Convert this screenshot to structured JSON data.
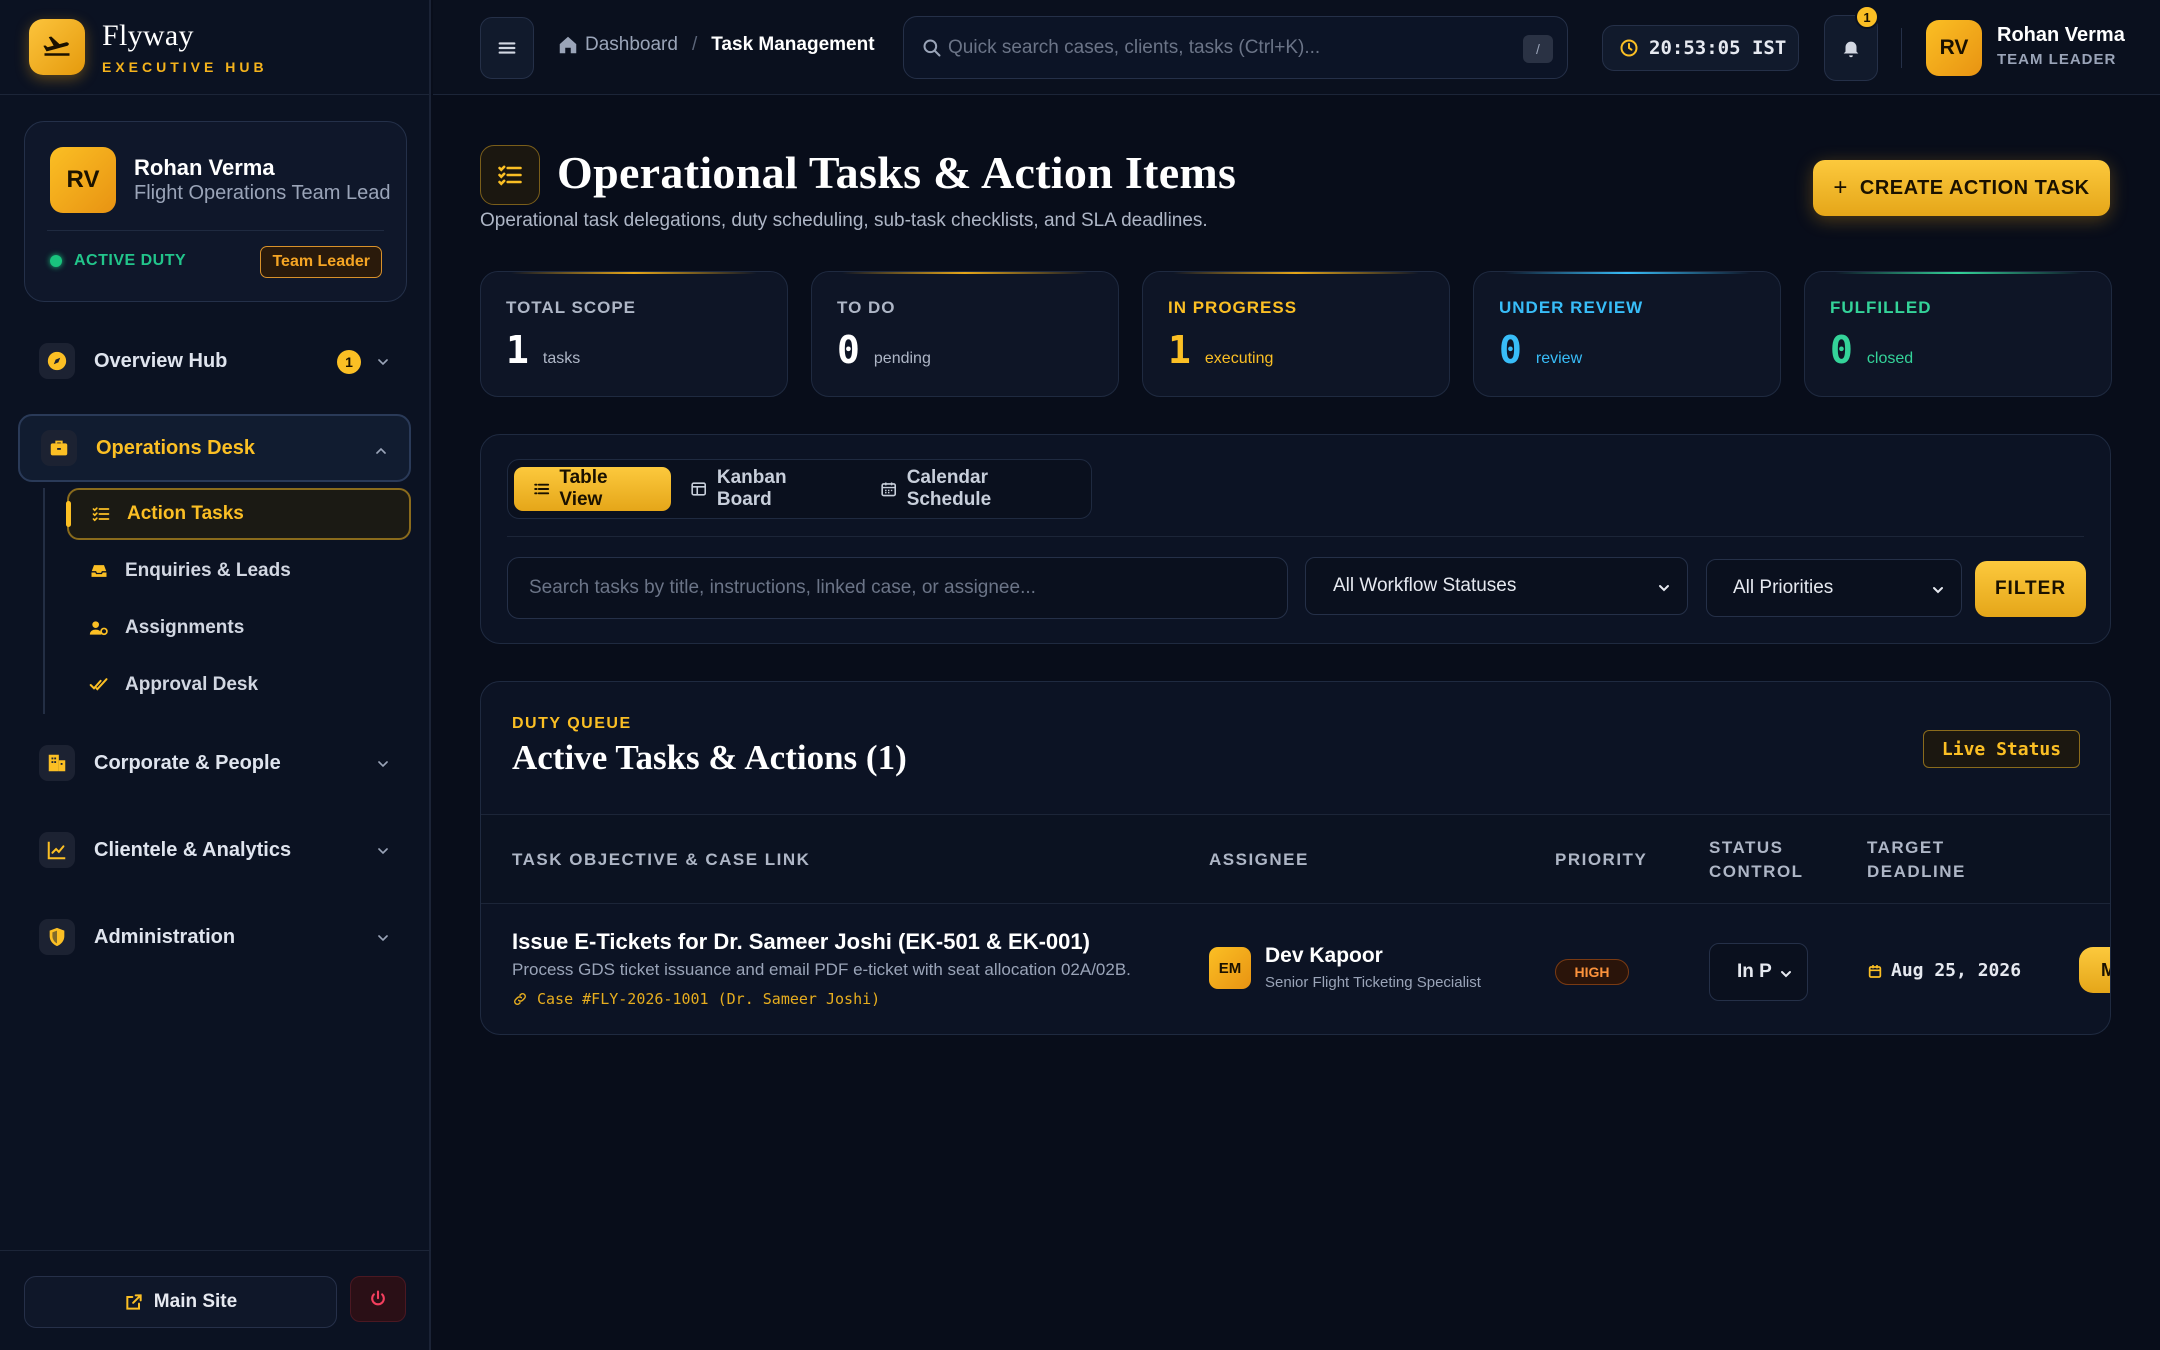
{
  "brand": {
    "title": "Flyway",
    "subtitle": "EXECUTIVE HUB"
  },
  "profile": {
    "initials": "RV",
    "name": "Rohan Verma",
    "role": "Flight Operations Team Lead",
    "status": "ACTIVE DUTY",
    "badge": "Team Leader"
  },
  "nav": {
    "overview": {
      "label": "Overview Hub",
      "count": "1"
    },
    "operations": {
      "label": "Operations Desk"
    },
    "sub": [
      {
        "label": "Action Tasks"
      },
      {
        "label": "Enquiries & Leads"
      },
      {
        "label": "Assignments"
      },
      {
        "label": "Approval Desk"
      }
    ],
    "corporate": {
      "label": "Corporate & People"
    },
    "clientele": {
      "label": "Clientele & Analytics"
    },
    "admin": {
      "label": "Administration"
    }
  },
  "footer": {
    "main_site": "Main Site"
  },
  "topbar": {
    "breadcrumb_home": "Dashboard",
    "breadcrumb_sep": "/",
    "breadcrumb_current": "Task Management",
    "search_placeholder": "Quick search cases, clients, tasks (Ctrl+K)...",
    "search_kbd": "/",
    "clock": "20:53:05 IST",
    "notif_count": "1",
    "user_initials": "RV",
    "user_name": "Rohan Verma",
    "user_role": "TEAM LEADER"
  },
  "page": {
    "title": "Operational Tasks & Action Items",
    "subtitle": "Operational task delegations, duty scheduling, sub-task checklists, and SLA deadlines.",
    "create_plus": "+",
    "create_label": "CREATE ACTION TASK"
  },
  "stats": [
    {
      "label": "TOTAL SCOPE",
      "value": "1",
      "unit": "tasks",
      "color": "#aeb6c6",
      "accent": "#e5a619"
    },
    {
      "label": "TO DO",
      "value": "0",
      "unit": "pending",
      "color": "#aeb6c6",
      "accent": "#e5a619"
    },
    {
      "label": "IN PROGRESS",
      "value": "1",
      "unit": "executing",
      "color": "#fbbf24",
      "accent": "#e5a619"
    },
    {
      "label": "UNDER REVIEW",
      "value": "0",
      "unit": "review",
      "color": "#38bdf8",
      "accent": "#38bdf8"
    },
    {
      "label": "FULFILLED",
      "value": "0",
      "unit": "closed",
      "color": "#34d399",
      "accent": "#34d399"
    }
  ],
  "views": {
    "table": "Table View",
    "kanban": "Kanban Board",
    "calendar": "Calendar Schedule"
  },
  "filters": {
    "search_placeholder": "Search tasks by title, instructions, linked case, or assignee...",
    "status_selected": "All Workflow Statuses",
    "priority_selected": "All Priorities",
    "filter_button": "FILTER"
  },
  "queue": {
    "eyebrow": "DUTY QUEUE",
    "title": "Active Tasks & Actions (1)",
    "live_label": "Live Status",
    "headers": {
      "task": "TASK OBJECTIVE & CASE LINK",
      "assignee": "ASSIGNEE",
      "priority": "PRIORITY",
      "status_1": "STATUS",
      "status_2": "CONTROL",
      "deadline_1": "TARGET",
      "deadline_2": "DEADLINE"
    },
    "rows": [
      {
        "title": "Issue E-Tickets for Dr. Sameer Joshi (EK-501 & EK-001)",
        "description": "Process GDS ticket issuance and email PDF e-ticket with seat allocation 02A/02B.",
        "case_link": "Case #FLY-2026-1001 (Dr. Sameer Joshi)",
        "assignee_initials": "EM",
        "assignee_name": "Dev Kapoor",
        "assignee_role": "Senior Flight Ticketing Specialist",
        "priority": "HIGH",
        "status": "In P",
        "deadline": "Aug 25, 2026",
        "action": "M"
      }
    ]
  }
}
